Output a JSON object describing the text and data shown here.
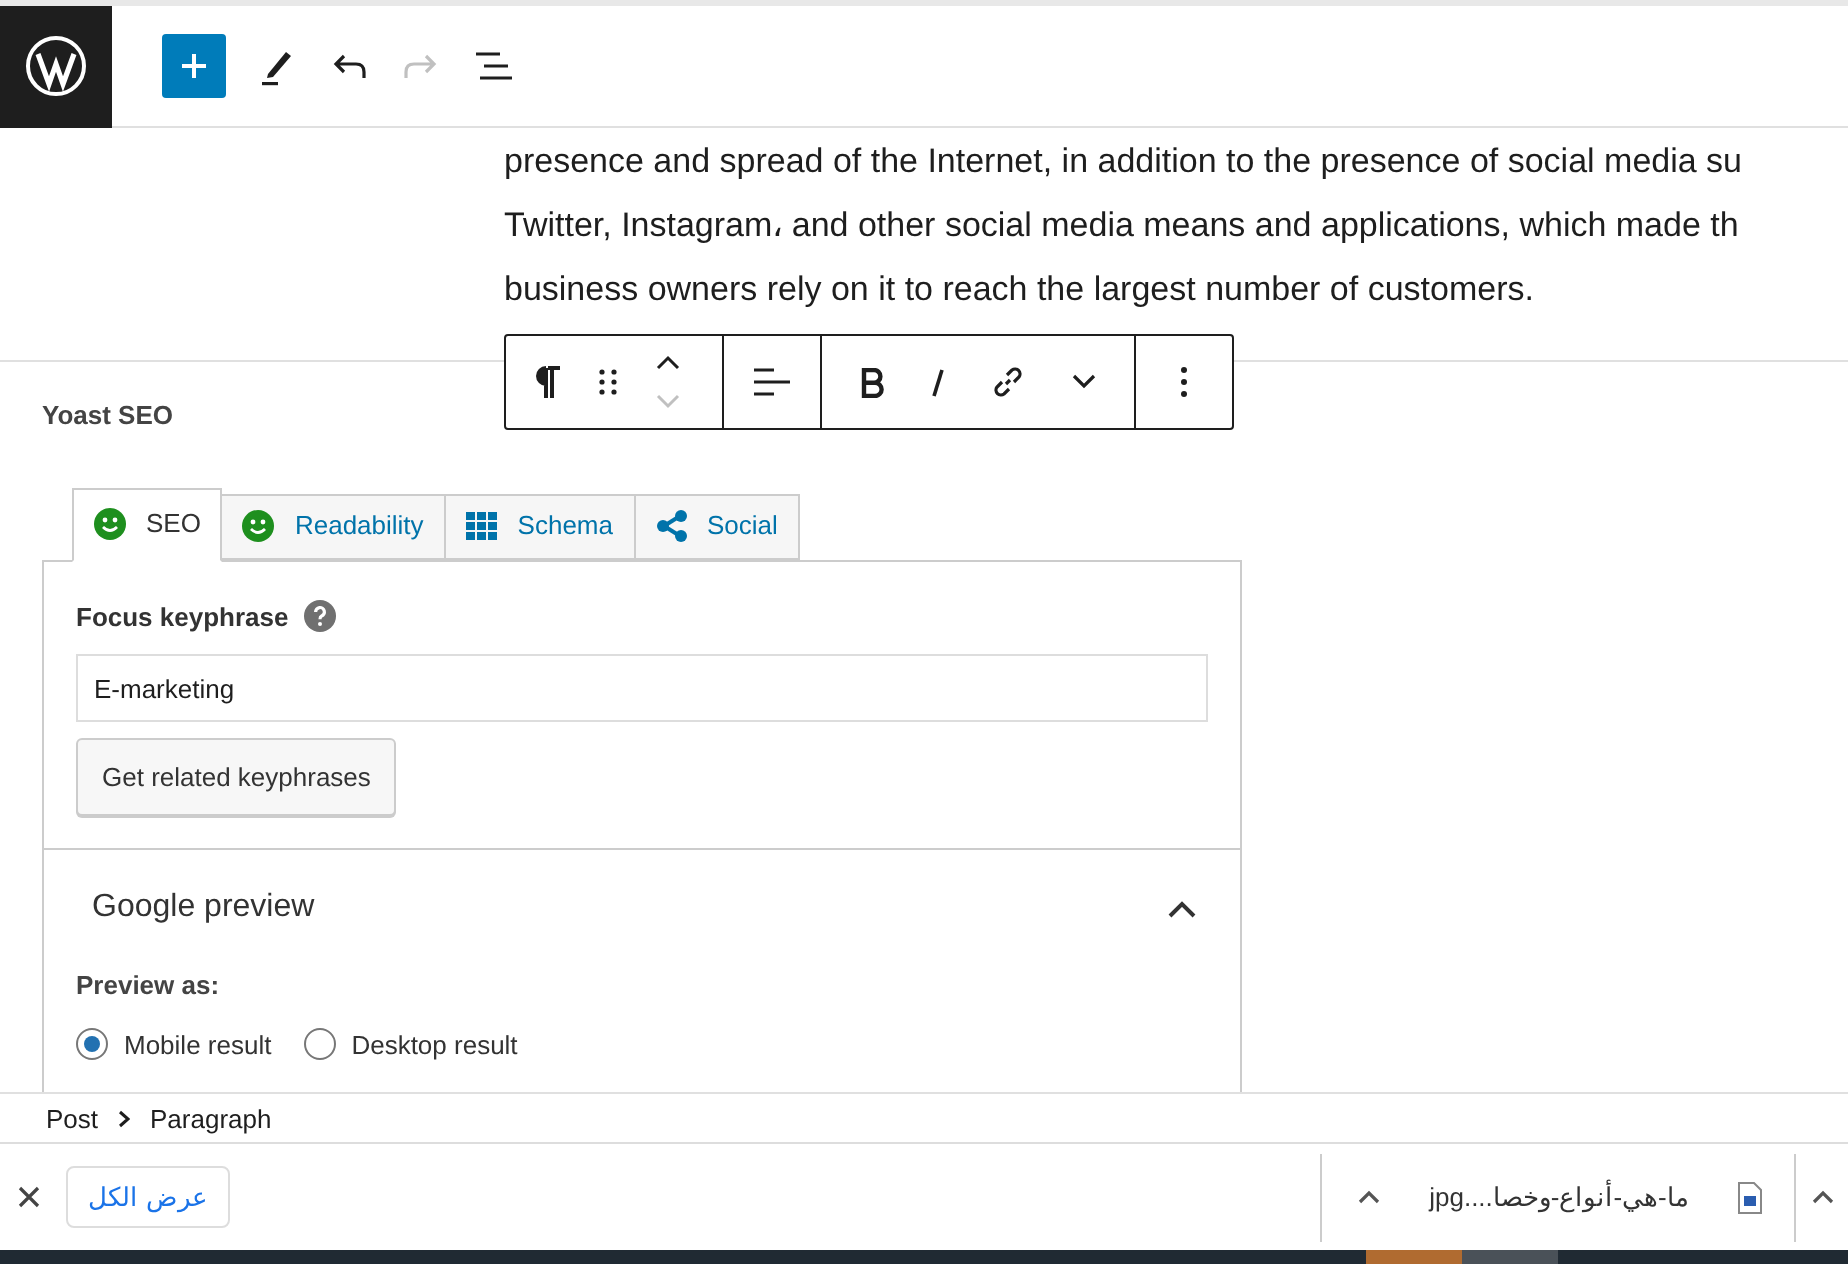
{
  "paragraph_lines": [
    "presence and spread of the Internet, in addition to the presence of social media su",
    "Twitter, Instagram، and other social media means and applications, which made th",
    "business owners rely on it to reach the largest number of customers."
  ],
  "yoast": {
    "title": "Yoast SEO",
    "tabs": [
      {
        "label": "SEO",
        "kind": "score",
        "selected": true
      },
      {
        "label": "Readability",
        "kind": "score",
        "selected": false
      },
      {
        "label": "Schema",
        "kind": "schema",
        "selected": false
      },
      {
        "label": "Social",
        "kind": "social",
        "selected": false
      }
    ],
    "focus_label": "Focus keyphrase",
    "focus_value": "E-marketing",
    "related_button": "Get related keyphrases",
    "preview_title": "Google preview",
    "expanded": true,
    "preview_as": "Preview as:",
    "radios": [
      {
        "label": "Mobile result",
        "selected": true
      },
      {
        "label": "Desktop result",
        "selected": false
      }
    ]
  },
  "breadcrumb": [
    "Post",
    "Paragraph"
  ],
  "downloads": {
    "show_all": "عرض الكل",
    "file": "ما-هي-أنواع-وخصا....jpg"
  }
}
